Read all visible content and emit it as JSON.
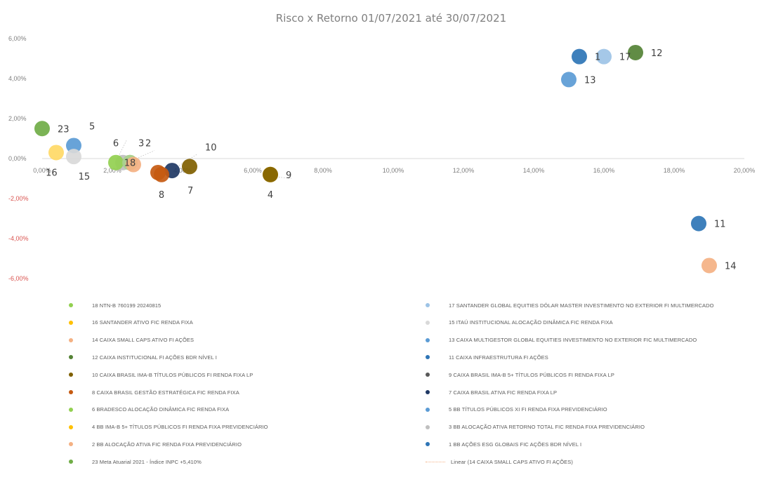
{
  "chart_data": {
    "type": "scatter",
    "title": "Risco x Retorno 01/07/2021 até 30/07/2021",
    "xlabel": "",
    "ylabel": "",
    "xlim": [
      0,
      20
    ],
    "ylim": [
      -6,
      6
    ],
    "x_ticks": [
      0,
      2,
      4,
      6,
      8,
      10,
      12,
      14,
      16,
      18,
      20
    ],
    "y_ticks": [
      -6,
      -4,
      -2,
      0,
      2,
      4,
      6
    ],
    "x_tick_labels": [
      "0,00%",
      "2,00%",
      "4,00%",
      "6,00%",
      "8,00%",
      "10,00%",
      "12,00%",
      "14,00%",
      "16,00%",
      "18,00%",
      "20,00%"
    ],
    "y_tick_labels": [
      "-6,00%",
      "-4,00%",
      "-2,00%",
      "0,00%",
      "2,00%",
      "4,00%",
      "6,00%"
    ],
    "grid": "horizontal at 0 only",
    "legend_position": "bottom, two columns",
    "points": [
      {
        "id": "1",
        "x": 15.3,
        "y": 5.1,
        "color": "#2e75b6",
        "label": "1",
        "label_dx": 1,
        "label_dy": 0
      },
      {
        "id": "2",
        "x": 2.5,
        "y": -0.2,
        "color": "#a9d18e",
        "label": "2",
        "label_dx": 1,
        "label_dy": -1
      },
      {
        "id": "3",
        "x": 2.3,
        "y": -0.2,
        "color": "#bfbfbf",
        "label": "3",
        "label_dx": 1,
        "label_dy": -1
      },
      {
        "id": "4",
        "x": 6.5,
        "y": -0.8,
        "color": "#ffc000",
        "label": "4",
        "label_dx": 0,
        "label_dy": 1
      },
      {
        "id": "5",
        "x": 0.9,
        "y": 0.65,
        "color": "#5b9bd5",
        "label": "5",
        "label_dx": 1,
        "label_dy": -1
      },
      {
        "id": "6",
        "x": 2.1,
        "y": -0.2,
        "color": "#92d050",
        "label": "6",
        "label_dx": 0,
        "label_dy": -1
      },
      {
        "id": "7",
        "x": 3.7,
        "y": -0.6,
        "color": "#1f3864",
        "label": "7",
        "label_dx": 1,
        "label_dy": 1
      },
      {
        "id": "8",
        "x": 3.4,
        "y": -0.8,
        "color": "#c55a11",
        "label": "8",
        "label_dx": 0,
        "label_dy": 1
      },
      {
        "id": "9",
        "x": 6.5,
        "y": -0.8,
        "color": "#7f6000",
        "label": "9",
        "label_dx": 1,
        "label_dy": 0
      },
      {
        "id": "10",
        "x": 4.2,
        "y": -0.4,
        "color": "#806000",
        "label": "10",
        "label_dx": 1,
        "label_dy": -1
      },
      {
        "id": "11",
        "x": 18.7,
        "y": -3.25,
        "color": "#2e75b6",
        "label": "11",
        "label_dx": 1,
        "label_dy": 0
      },
      {
        "id": "12",
        "x": 16.9,
        "y": 5.3,
        "color": "#548235",
        "label": "12",
        "label_dx": 1,
        "label_dy": 0
      },
      {
        "id": "13",
        "x": 15.0,
        "y": 3.95,
        "color": "#5b9bd5",
        "label": "13",
        "label_dx": 1,
        "label_dy": 0
      },
      {
        "id": "14",
        "x": 19.0,
        "y": -5.35,
        "color": "#f4b183",
        "label": "14",
        "label_dx": 1,
        "label_dy": 0
      },
      {
        "id": "15",
        "x": 0.9,
        "y": 0.1,
        "color": "#d9d9d9",
        "label": "15",
        "label_dx": 0.3,
        "label_dy": 1
      },
      {
        "id": "16",
        "x": 0.4,
        "y": 0.3,
        "color": "#ffd966",
        "label": "16",
        "label_dx": -0.3,
        "label_dy": 1
      },
      {
        "id": "17",
        "x": 16.0,
        "y": 5.1,
        "color": "#9dc3e6",
        "label": "17",
        "label_dx": 1,
        "label_dy": 0
      },
      {
        "id": "18",
        "x": 2.5,
        "y": -0.2,
        "color": "#a9d18e",
        "label": "18",
        "label_dx": 0,
        "label_dy": 0
      },
      {
        "id": "23",
        "x": 0.0,
        "y": 1.5,
        "color": "#70ad47",
        "label": "23",
        "label_dx": 1,
        "label_dy": 0
      },
      {
        "id": "3b",
        "x": 2.6,
        "y": -0.3,
        "color": "#f4b183",
        "label": "",
        "label_dx": 0,
        "label_dy": 0
      },
      {
        "id": "18b",
        "x": 3.3,
        "y": -0.7,
        "color": "#c55a11",
        "label": "",
        "label_dx": 0,
        "label_dy": 0
      }
    ]
  },
  "legend": {
    "left": [
      {
        "color": "#92d050",
        "text": "18 NTN-B 760199 20240815"
      },
      {
        "color": "#ffc000",
        "text": "16 SANTANDER ATIVO FIC RENDA FIXA"
      },
      {
        "color": "#f4b183",
        "text": "14 CAIXA SMALL CAPS ATIVO FI AÇÕES"
      },
      {
        "color": "#548235",
        "text": "12 CAIXA INSTITUCIONAL FI AÇÕES BDR NÍVEL I"
      },
      {
        "color": "#7f6000",
        "text": "10 CAIXA BRASIL IMA-B TÍTULOS PÚBLICOS FI RENDA FIXA LP"
      },
      {
        "color": "#c55a11",
        "text": "8 CAIXA BRASIL GESTÃO ESTRATÉGICA FIC RENDA FIXA"
      },
      {
        "color": "#92d050",
        "text": "6 BRADESCO ALOCAÇÃO DINÂMICA FIC RENDA FIXA"
      },
      {
        "color": "#ffc000",
        "text": "4 BB IMA-B 5+ TÍTULOS PÚBLICOS FI RENDA FIXA PREVIDENCIÁRIO"
      },
      {
        "color": "#f4b183",
        "text": "2 BB ALOCAÇÃO ATIVA FIC RENDA FIXA PREVIDENCIÁRIO"
      },
      {
        "color": "#70ad47",
        "text": "23 Meta Atuarial 2021 - Índice INPC +5,410%"
      }
    ],
    "right": [
      {
        "color": "#9dc3e6",
        "text": "17 SANTANDER GLOBAL EQUITIES DÓLAR MASTER INVESTIMENTO NO EXTERIOR FI MULTIMERCADO"
      },
      {
        "color": "#d9d9d9",
        "text": "15 ITAÚ INSTITUCIONAL ALOCAÇÃO DINÂMICA FIC RENDA FIXA"
      },
      {
        "color": "#5b9bd5",
        "text": "13 CAIXA MULTIGESTOR GLOBAL EQUITIES INVESTIMENTO NO EXTERIOR FIC MULTIMERCADO"
      },
      {
        "color": "#2e75b6",
        "text": "11 CAIXA INFRAESTRUTURA FI AÇÕES"
      },
      {
        "color": "#595959",
        "text": "9 CAIXA BRASIL IMA-B 5+ TÍTULOS PÚBLICOS FI RENDA FIXA LP"
      },
      {
        "color": "#1f3864",
        "text": "7 CAIXA BRASIL ATIVA FIC RENDA FIXA LP"
      },
      {
        "color": "#5b9bd5",
        "text": "5 BB TÍTULOS PÚBLICOS XI FI RENDA FIXA PREVIDENCIÁRIO"
      },
      {
        "color": "#bfbfbf",
        "text": "3 BB ALOCAÇÃO ATIVA RETORNO TOTAL FIC RENDA FIXA PREVIDENCIÁRIO"
      },
      {
        "color": "#2e75b6",
        "text": "1 BB AÇÕES ESG GLOBAIS FIC AÇÕES BDR NÍVEL I"
      },
      {
        "color": "#f4b183",
        "text": "Linear (14 CAIXA SMALL CAPS ATIVO FI AÇÕES)",
        "line": true
      }
    ]
  }
}
